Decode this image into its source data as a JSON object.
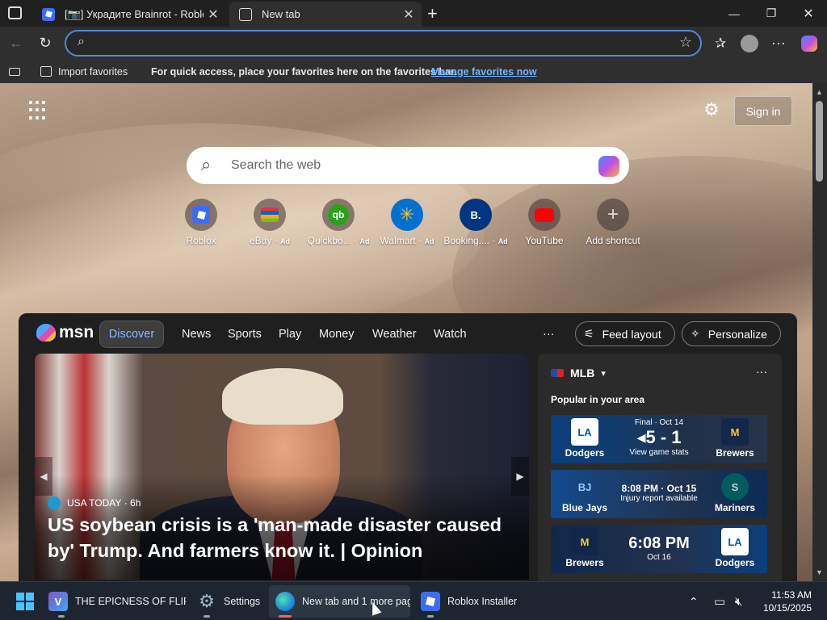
{
  "tabs": [
    {
      "title": "[📷] Украдите Brainrot - Roblox",
      "active": false
    },
    {
      "title": "New tab",
      "active": true
    }
  ],
  "toolbar": {
    "address_value": "",
    "address_placeholder": ""
  },
  "favorites_bar": {
    "import_label": "Import favorites",
    "hint": "For quick access, place your favorites here on the favorites bar.",
    "manage_link": "Manage favorites now"
  },
  "newtab": {
    "sign_in": "Sign in",
    "search_placeholder": "Search the web",
    "shortcuts": [
      {
        "label": "Roblox",
        "ad": "",
        "icon": "roblox-icon",
        "glyph": "▣",
        "color": "#3b6df0"
      },
      {
        "label": "eBay",
        "ad": "Ad",
        "icon": "ebay-icon",
        "glyph": "▤",
        "color": "#ffcf00"
      },
      {
        "label": "Quickbo...",
        "ad": "Ad",
        "icon": "quickbooks-icon",
        "glyph": "qb",
        "color": "#2ca01c"
      },
      {
        "label": "Walmart",
        "ad": "Ad",
        "icon": "walmart-icon",
        "glyph": "✳",
        "color": "#0071ce"
      },
      {
        "label": "Booking....",
        "ad": "Ad",
        "icon": "booking-icon",
        "glyph": "B.",
        "color": "#003580"
      },
      {
        "label": "YouTube",
        "ad": "",
        "icon": "youtube-icon",
        "glyph": "▶",
        "color": "#ff0000"
      },
      {
        "label": "Add shortcut",
        "ad": "",
        "icon": "plus-icon",
        "glyph": "+",
        "color": "#777777"
      }
    ]
  },
  "feed": {
    "brand": "msn",
    "nav": [
      "Discover",
      "News",
      "Sports",
      "Play",
      "Money",
      "Weather",
      "Watch"
    ],
    "more": "···",
    "feed_layout": "Feed layout",
    "personalize": "Personalize",
    "hero": {
      "source": "USA TODAY",
      "age": "· 6h",
      "headline": "US soybean crisis is a 'man-made disaster caused by' Trump. And farmers know it. | Opinion"
    },
    "mlb": {
      "title": "MLB",
      "popular": "Popular in your area",
      "games": [
        {
          "home": "Dodgers",
          "home_logo": "LA",
          "away": "Brewers",
          "away_logo": "M",
          "status": "Final · Oct 14",
          "main": "◂5 - 1",
          "sub": "View game stats"
        },
        {
          "home": "Blue Jays",
          "home_logo": "BJ",
          "away": "Mariners",
          "away_logo": "S",
          "status": "",
          "main": "8:08 PM · Oct 15",
          "sub": "Injury report available"
        },
        {
          "home": "Brewers",
          "home_logo": "M",
          "away": "Dodgers",
          "away_logo": "LA",
          "status": "",
          "main": "6:08 PM",
          "sub": "Oct 16"
        }
      ]
    }
  },
  "taskbar": {
    "items": [
      {
        "label": "THE EPICNESS OF FLIPP",
        "icon": "visual-studio-icon"
      },
      {
        "label": "Settings",
        "icon": "settings-gear-icon"
      },
      {
        "label": "New tab and 1 more pag",
        "icon": "edge-icon"
      },
      {
        "label": "Roblox Installer",
        "icon": "roblox-icon"
      }
    ],
    "time": "11:53 AM",
    "date": "10/15/2025"
  }
}
